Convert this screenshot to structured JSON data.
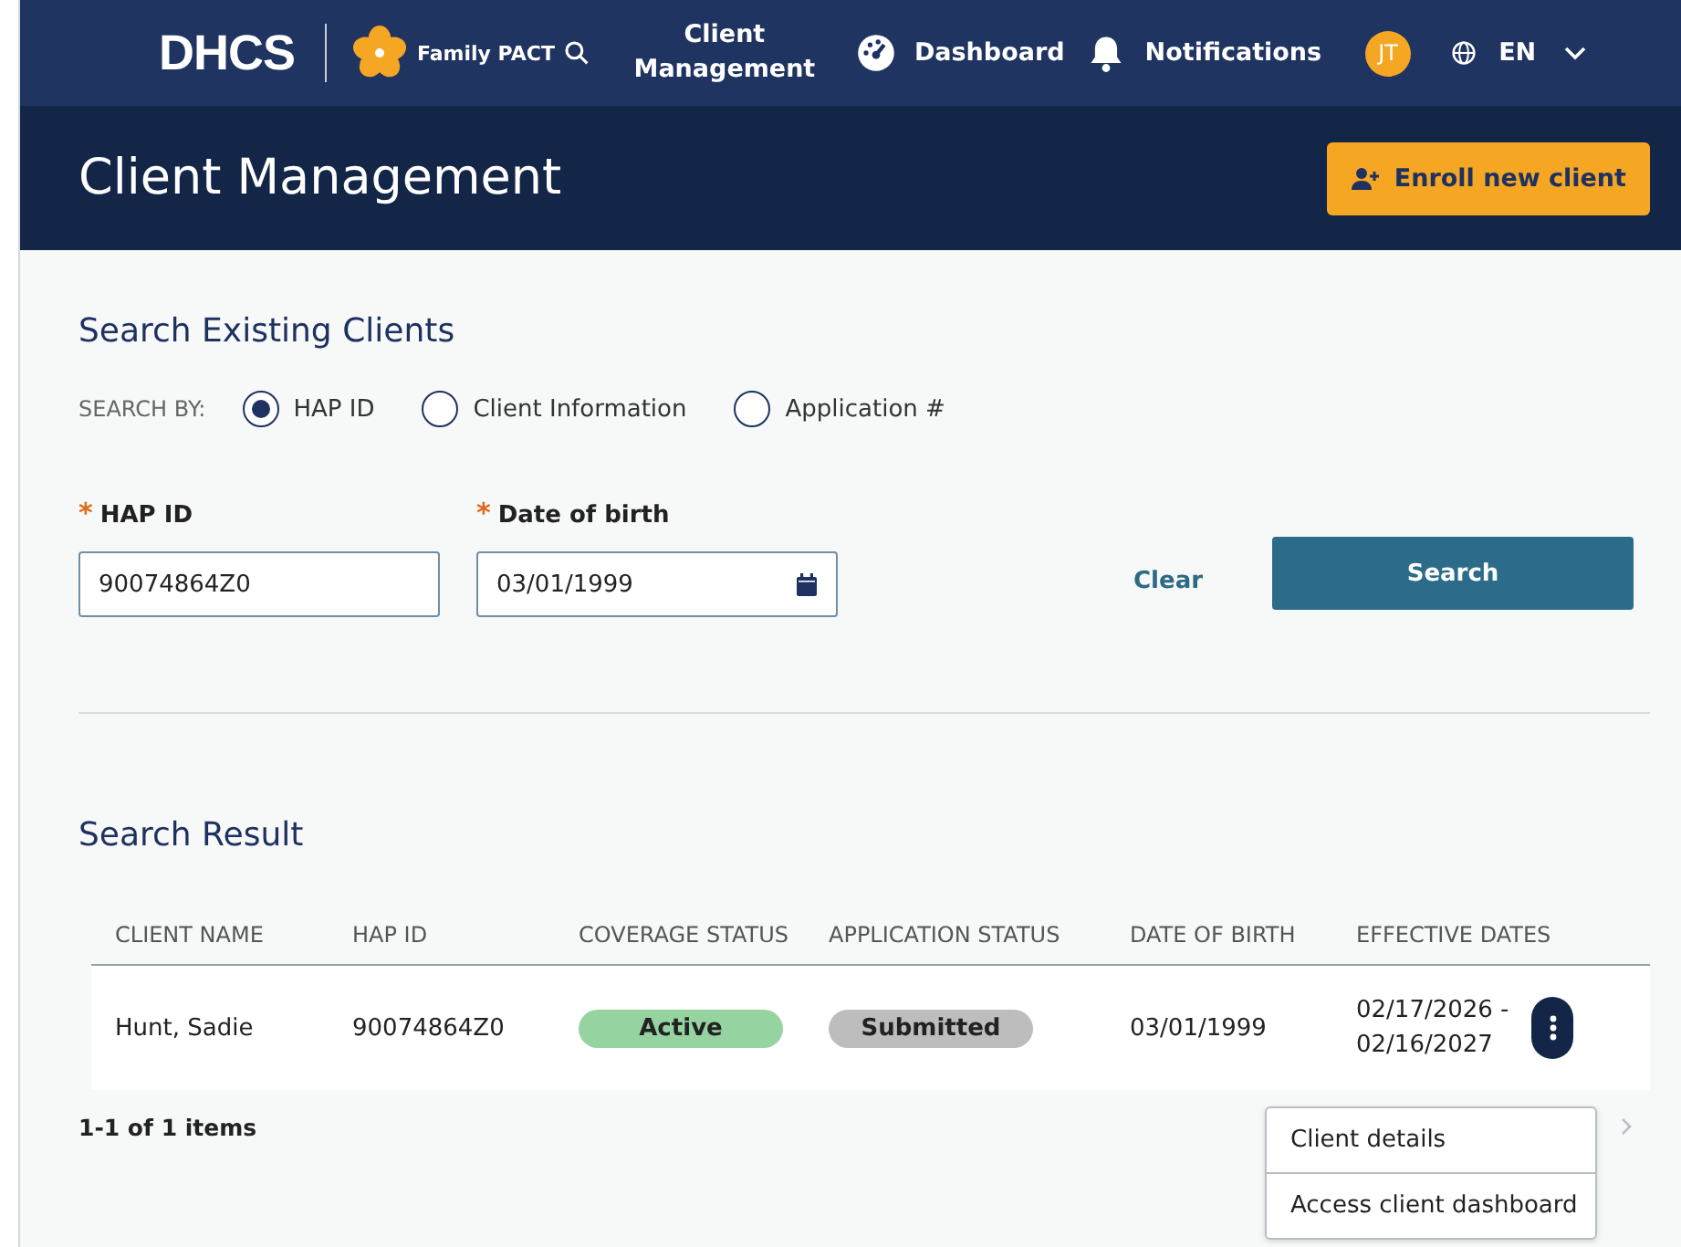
{
  "nav": {
    "logo": "DHCS",
    "program": "Family PACT",
    "links": [
      {
        "label": "Client Management",
        "kind": "text"
      },
      {
        "label": "Dashboard",
        "kind": "dashboard"
      },
      {
        "label": "Notifications",
        "kind": "notifications"
      }
    ],
    "avatar": "JT",
    "language": "EN"
  },
  "page_title": "Client Management",
  "enroll_button": "Enroll new client",
  "search": {
    "title": "Search Existing Clients",
    "search_by_label": "SEARCH BY:",
    "options": [
      {
        "label": "HAP ID",
        "selected": true
      },
      {
        "label": "Client Information",
        "selected": false
      },
      {
        "label": "Application #",
        "selected": false
      }
    ],
    "fields": [
      {
        "required_mark": "*",
        "label": "HAP ID",
        "value": "90074864Z0",
        "kind": "text"
      },
      {
        "required_mark": "*",
        "label": "Date of birth",
        "value": "03/01/1999",
        "kind": "date"
      }
    ],
    "clear": "Clear",
    "submit": "Search"
  },
  "results": {
    "title": "Search Result",
    "columns": [
      "CLIENT NAME",
      "HAP ID",
      "COVERAGE STATUS",
      "APPLICATION STATUS",
      "DATE OF BIRTH",
      "EFFECTIVE DATES"
    ],
    "rows": [
      {
        "name": "Hunt, Sadie",
        "hap_id": "90074864Z0",
        "coverage_status": {
          "text": "Active",
          "color": "#95d3a0"
        },
        "application_status": {
          "text": "Submitted",
          "color": "#bdbdbd"
        },
        "date_of_birth": "03/01/1999",
        "effective_dates": "02/17/2026 - 02/16/2027"
      }
    ],
    "pagination": "1-1 of 1 items",
    "row_menu": [
      "Client details",
      "Access client dashboard"
    ]
  }
}
